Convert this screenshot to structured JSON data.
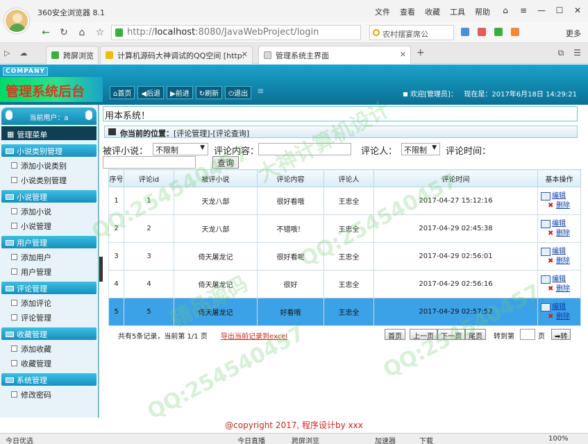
{
  "browser": {
    "window_title": "360安全浏览器 8.1",
    "menus": [
      "文件",
      "查看",
      "收藏",
      "工具",
      "帮助"
    ],
    "url_gray_prefix": "http://",
    "url_host": "localhost",
    "url_rest": ":8080/JavaWebProject/login",
    "search_text": "农村摆宴席公",
    "more_label": "更多",
    "tabs": [
      {
        "label": "跨屏浏览"
      },
      {
        "label": "计算机源码大神调试的QQ空间 [http:"
      },
      {
        "label": "管理系统主界面"
      }
    ]
  },
  "header": {
    "company": "COMPANY",
    "title": "管理系统后台",
    "nav": [
      "首页",
      "后退",
      "前进",
      "刷新",
      "退出"
    ],
    "welcome": "欢迎[管理员]",
    "date_prefix": "现在是：",
    "datetime": "2017年6月18日 14:29:21"
  },
  "sidebar": {
    "current_user_label": "当前用户：a",
    "menu_title": "管理菜单",
    "groups": [
      {
        "title": "小说类别管理",
        "items": [
          "添加小说类别",
          "小说类别管理"
        ]
      },
      {
        "title": "小说管理",
        "items": [
          "添加小说",
          "小说管理"
        ]
      },
      {
        "title": "用户管理",
        "items": [
          "添加用户",
          "用户管理"
        ]
      },
      {
        "title": "评论管理",
        "items": [
          "添加评论",
          "评论管理"
        ]
      },
      {
        "title": "收藏管理",
        "items": [
          "添加收藏",
          "收藏管理"
        ]
      },
      {
        "title": "系统管理",
        "items": [
          "修改密码"
        ]
      }
    ]
  },
  "main": {
    "marquee": "用本系统！",
    "location_label": "你当前的位置：",
    "location_path": "[评论管理]-[评论查询]",
    "filter": {
      "novel_label": "被评小说：",
      "novel_value": "不限制",
      "content_label": "评论内容：",
      "user_label": "评论人：",
      "user_value": "不限制",
      "time_label": "评论时间：",
      "query_button": "查询"
    },
    "table": {
      "headers": [
        "序号",
        "评论id",
        "被评小说",
        "评论内容",
        "评论人",
        "评论时间",
        "基本操作"
      ],
      "edit_label": "编辑",
      "delete_label": "删除",
      "rows": [
        {
          "no": "1",
          "id": "1",
          "novel": "天龙八部",
          "content": "很好看哦",
          "user": "王忠全",
          "time": "2017-04-27 15:12:16"
        },
        {
          "no": "2",
          "id": "2",
          "novel": "天龙八部",
          "content": "不错哦！",
          "user": "王忠全",
          "time": "2017-04-29 02:45:38"
        },
        {
          "no": "3",
          "id": "3",
          "novel": "倚天屠龙记",
          "content": "很好看呢",
          "user": "王忠全",
          "time": "2017-04-29 02:56:01"
        },
        {
          "no": "4",
          "id": "4",
          "novel": "倚天屠龙记",
          "content": "很好",
          "user": "王忠全",
          "time": "2017-04-29 02:56:16"
        },
        {
          "no": "5",
          "id": "5",
          "novel": "倚天屠龙记",
          "content": "好看哦",
          "user": "王忠全",
          "time": "2017-04-29 02:57:52"
        }
      ]
    },
    "pager": {
      "summary": "共有5条记录，当前第 1/1 页",
      "export": "导出当前记录到excel",
      "first": "首页",
      "prev": "上一页",
      "next": "下一页",
      "last": "尾页",
      "goto_label": "转到第",
      "page_unit": "页",
      "go": "转"
    }
  },
  "footer": {
    "copyright": "@copyright 2017, 程序设计by xxx"
  },
  "statusbar": {
    "left": "今日优选",
    "live": "今日直播",
    "cross": "跨屏浏览",
    "accel": "加速器",
    "download": "下载",
    "zoom": "100%"
  },
  "watermark": {
    "text_qq": "QQ:254540457",
    "text_src": "精品源码",
    "text_design": "大神计算机设计"
  },
  "colors": {
    "header_blue": "#1aa3c9",
    "title_red": "#d63a1a",
    "selected_row": "#3ca2e8",
    "copyright_red": "#c3261b"
  }
}
